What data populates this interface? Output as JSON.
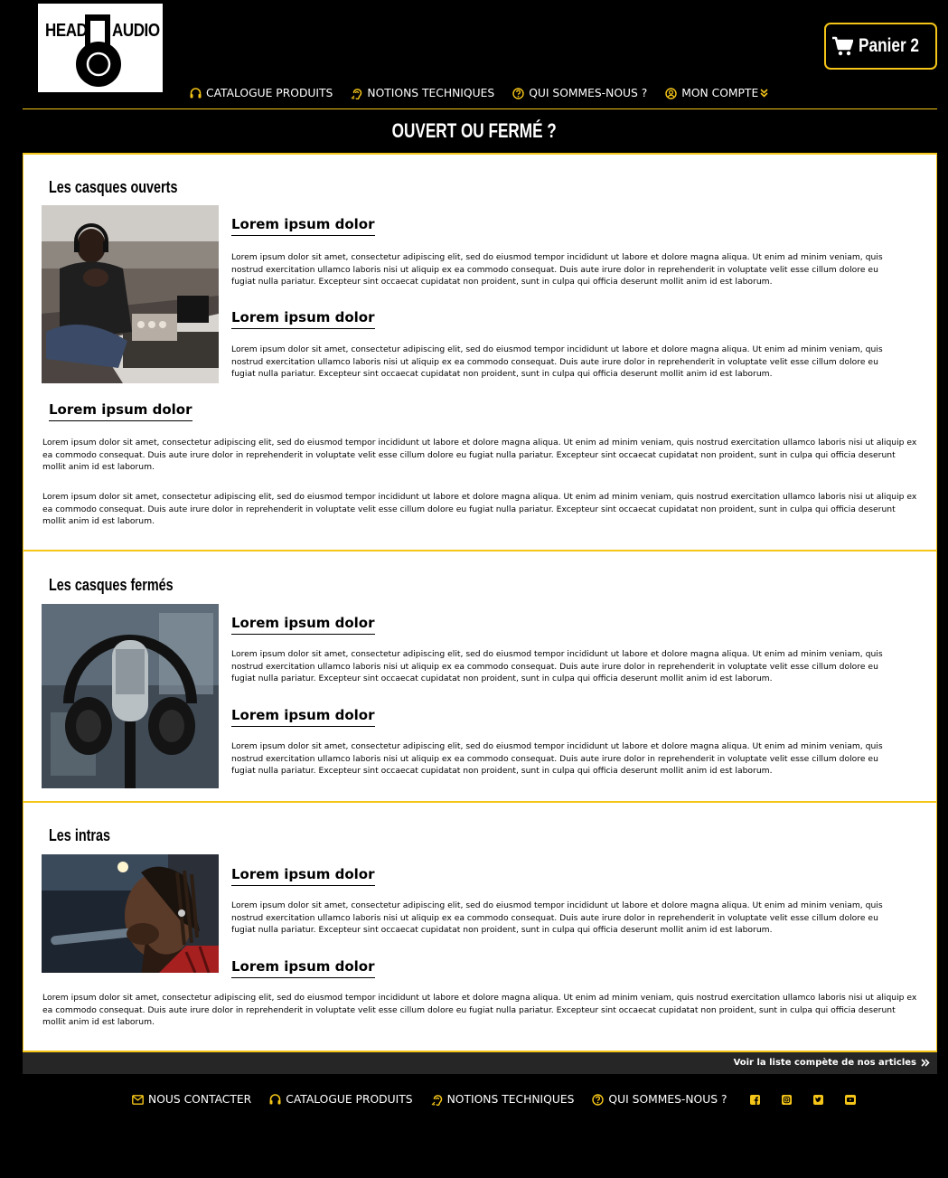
{
  "brand": {
    "head": "HEAD",
    "audio": "AUDIO"
  },
  "cart": {
    "label": "Panier 2",
    "icon": "shopping-cart-icon"
  },
  "colors": {
    "accent": "#f5c518",
    "background": "#000000",
    "panel": "#ffffff",
    "bar": "#262626"
  },
  "nav": [
    {
      "label": "CATALOGUE PRODUITS",
      "icon": "headphones-icon"
    },
    {
      "label": "NOTIONS TECHNIQUES",
      "icon": "ear-icon"
    },
    {
      "label": "QUI SOMMES-NOUS ?",
      "icon": "question-circle-icon"
    },
    {
      "label": "MON COMPTE",
      "icon": "user-circle-icon",
      "suffix_icon": "double-chevron-down-icon"
    }
  ],
  "page_title": "OUVERT OU FERMÉ ?",
  "sections": [
    {
      "heading": "Les casques ouverts",
      "image": "man-with-headphones-in-studio",
      "blocks": [
        {
          "title": "Lorem ipsum dolor",
          "text": "Lorem ipsum dolor sit amet, consectetur adipiscing elit, sed do eiusmod tempor incididunt ut labore et dolore magna aliqua. Ut enim ad minim veniam, quis nostrud exercitation ullamco laboris nisi ut aliquip ex ea commodo consequat. Duis aute irure dolor in reprehenderit in voluptate velit esse cillum dolore eu fugiat nulla pariatur. Excepteur sint occaecat cupidatat non proident, sunt in culpa qui officia deserunt mollit anim id est laborum."
        },
        {
          "title": "Lorem ipsum dolor",
          "text": "Lorem ipsum dolor sit amet, consectetur adipiscing elit, sed do eiusmod tempor incididunt ut labore et dolore magna aliqua. Ut enim ad minim veniam, quis nostrud exercitation ullamco laboris nisi ut aliquip ex ea commodo consequat. Duis aute irure dolor in reprehenderit in voluptate velit esse cillum dolore eu fugiat nulla pariatur. Excepteur sint occaecat cupidatat non proident, sunt in culpa qui officia deserunt mollit anim id est laborum."
        },
        {
          "title": "Lorem ipsum dolor",
          "text": "Lorem ipsum dolor sit amet, consectetur adipiscing elit, sed do eiusmod tempor incididunt ut labore et dolore magna aliqua. Ut enim ad minim veniam, quis nostrud exercitation ullamco laboris nisi ut aliquip ex ea commodo consequat. Duis aute irure dolor in reprehenderit in voluptate velit esse cillum dolore eu fugiat nulla pariatur. Excepteur sint occaecat cupidatat non proident, sunt in culpa qui officia deserunt mollit anim id est laborum."
        },
        {
          "title": "",
          "text": "Lorem ipsum dolor sit amet, consectetur adipiscing elit, sed do eiusmod tempor incididunt ut labore et dolore magna aliqua. Ut enim ad minim veniam, quis nostrud exercitation ullamco laboris nisi ut aliquip ex ea commodo consequat. Duis aute irure dolor in reprehenderit in voluptate velit esse cillum dolore eu fugiat nulla pariatur. Excepteur sint occaecat cupidatat non proident, sunt in culpa qui officia deserunt mollit anim id est laborum."
        }
      ]
    },
    {
      "heading": "Les casques fermés",
      "image": "headphones-on-microphone",
      "blocks": [
        {
          "title": "Lorem ipsum dolor",
          "text": "Lorem ipsum dolor sit amet, consectetur adipiscing elit, sed do eiusmod tempor incididunt ut labore et dolore magna aliqua. Ut enim ad minim veniam, quis nostrud exercitation ullamco laboris nisi ut aliquip ex ea commodo consequat. Duis aute irure dolor in reprehenderit in voluptate velit esse cillum dolore eu fugiat nulla pariatur. Excepteur sint occaecat cupidatat non proident, sunt in culpa qui officia deserunt mollit anim id est laborum."
        },
        {
          "title": "Lorem ipsum dolor",
          "text": "Lorem ipsum dolor sit amet, consectetur adipiscing elit, sed do eiusmod tempor incididunt ut labore et dolore magna aliqua. Ut enim ad minim veniam, quis nostrud exercitation ullamco laboris nisi ut aliquip ex ea commodo consequat. Duis aute irure dolor in reprehenderit in voluptate velit esse cillum dolore eu fugiat nulla pariatur. Excepteur sint occaecat cupidatat non proident, sunt in culpa qui officia deserunt mollit anim id est laborum."
        }
      ]
    },
    {
      "heading": "Les intras",
      "image": "singer-with-in-ear-monitor",
      "blocks": [
        {
          "title": "Lorem ipsum dolor",
          "text": "Lorem ipsum dolor sit amet, consectetur adipiscing elit, sed do eiusmod tempor incididunt ut labore et dolore magna aliqua. Ut enim ad minim veniam, quis nostrud exercitation ullamco laboris nisi ut aliquip ex ea commodo consequat. Duis aute irure dolor in reprehenderit in voluptate velit esse cillum dolore eu fugiat nulla pariatur. Excepteur sint occaecat cupidatat non proident, sunt in culpa qui officia deserunt mollit anim id est laborum."
        },
        {
          "title": "Lorem ipsum dolor",
          "text": "Lorem ipsum dolor sit amet, consectetur adipiscing elit, sed do eiusmod tempor incididunt ut labore et dolore magna aliqua. Ut enim ad minim veniam, quis nostrud exercitation ullamco laboris nisi ut aliquip ex ea commodo consequat. Duis aute irure dolor in reprehenderit in voluptate velit esse cillum dolore eu fugiat nulla pariatur. Excepteur sint occaecat cupidatat non proident, sunt in culpa qui officia deserunt mollit anim id est laborum."
        }
      ]
    }
  ],
  "more_link": "Voir la liste compète de nos articles",
  "footer": {
    "nav": [
      {
        "label": "NOUS CONTACTER",
        "icon": "envelope-icon"
      },
      {
        "label": "CATALOGUE PRODUITS",
        "icon": "headphones-icon"
      },
      {
        "label": "NOTIONS TECHNIQUES",
        "icon": "ear-icon"
      },
      {
        "label": "QUI SOMMES-NOUS ?",
        "icon": "question-circle-icon"
      }
    ],
    "social": [
      "facebook-icon",
      "instagram-icon",
      "twitter-icon",
      "youtube-icon"
    ]
  }
}
